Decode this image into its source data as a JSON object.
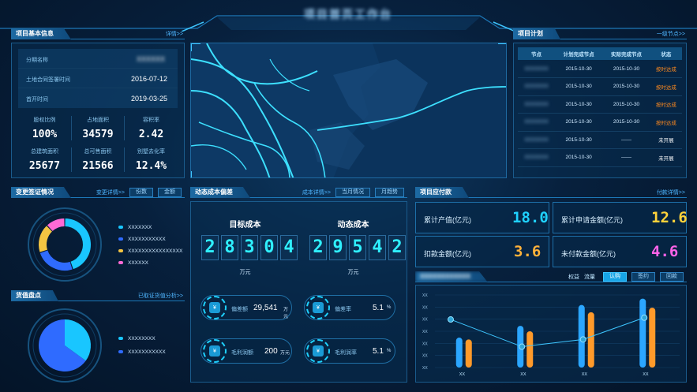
{
  "header": {
    "title": "项目首页工作台"
  },
  "project_info": {
    "title": "项目基本信息",
    "more": "详情>>",
    "rows": [
      {
        "label": "分期名称",
        "value": "XXXXXX"
      },
      {
        "label": "土地合同签署时间",
        "value": "2016-07-12"
      },
      {
        "label": "首开时间",
        "value": "2019-03-25"
      }
    ],
    "stats": [
      {
        "label": "股权比例",
        "value": "100%"
      },
      {
        "label": "占地面积",
        "value": "34579"
      },
      {
        "label": "容积率",
        "value": "2.42"
      },
      {
        "label": "总建筑面积",
        "value": "25677"
      },
      {
        "label": "总可售面积",
        "value": "21566"
      },
      {
        "label": "别墅去化率",
        "value": "12.4%"
      }
    ]
  },
  "change": {
    "title": "变更签证情况",
    "more": "变更详情>>",
    "buttons": [
      "份数",
      "金额"
    ],
    "legend": [
      {
        "label": "XXXXXXX",
        "color": "#19c6ff"
      },
      {
        "label": "XXXXXXXXXXX",
        "color": "#2f6bff"
      },
      {
        "label": "XXXXXXXXXXXXXXXX",
        "color": "#f4c542"
      },
      {
        "label": "XXXXXX",
        "color": "#ff6ad5"
      }
    ],
    "donut": [
      {
        "value": 45,
        "color": "#19c6ff"
      },
      {
        "value": 25,
        "color": "#2f6bff"
      },
      {
        "value": 18,
        "color": "#f4c542"
      },
      {
        "value": 12,
        "color": "#ff6ad5"
      }
    ]
  },
  "goods": {
    "title": "货值盘点",
    "more": "已取证货值分析>>",
    "legend": [
      {
        "label": "XXXXXXXX",
        "color": "#19c6ff"
      },
      {
        "label": "XXXXXXXXXXX",
        "color": "#2f6bff"
      }
    ],
    "pie": [
      {
        "value": 35,
        "color": "#19c6ff"
      },
      {
        "value": 65,
        "color": "#2f6bff"
      }
    ]
  },
  "plan": {
    "title": "项目计划",
    "more": "一级节点>>",
    "columns": [
      "节点",
      "计划完成节点",
      "实际完成节点",
      "状态"
    ],
    "rows": [
      {
        "node": "XXXXXXX",
        "plan": "2015-10-30",
        "actual": "2015-10-30",
        "status": "按时达成",
        "color": "#ff8a1f"
      },
      {
        "node": "XXXXXXX",
        "plan": "2015-10-30",
        "actual": "2015-10-30",
        "status": "按时达成",
        "color": "#ff8a1f"
      },
      {
        "node": "XXXXXXX",
        "plan": "2015-10-30",
        "actual": "2015-10-30",
        "status": "按时达成",
        "color": "#ff8a1f"
      },
      {
        "node": "XXXXXXX",
        "plan": "2015-10-30",
        "actual": "2015-10-30",
        "status": "按时达成",
        "color": "#ff8a1f"
      },
      {
        "node": "XXXXXXX",
        "plan": "2015-10-30",
        "actual": "——",
        "status": "未开展",
        "color": "#ffffff"
      },
      {
        "node": "XXXXXXX",
        "plan": "2015-10-30",
        "actual": "——",
        "status": "未开展",
        "color": "#ffffff"
      }
    ]
  },
  "cost": {
    "title": "动态成本偏差",
    "more": "成本详情>>",
    "buttons": [
      "当月情况",
      "月趋势"
    ],
    "target_label": "目标成本",
    "dynamic_label": "动态成本",
    "target_digits": [
      "2",
      "8",
      "3",
      "0",
      "4"
    ],
    "dynamic_digits": [
      "2",
      "9",
      "5",
      "4",
      "2"
    ],
    "unit": "万元",
    "items": [
      {
        "label": "偏差额",
        "value": "29,541",
        "unit": "万元"
      },
      {
        "label": "偏差率",
        "value": "5.1",
        "unit": "%"
      },
      {
        "label": "毛利润额",
        "value": "200",
        "unit": "万元"
      },
      {
        "label": "毛利润率",
        "value": "5.1",
        "unit": "%"
      }
    ]
  },
  "payable": {
    "title": "项目应付款",
    "more": "付款详情>>",
    "kpis": [
      {
        "label": "累计产值(亿元)",
        "value": "18.0",
        "color": "#1fd1ff"
      },
      {
        "label": "累计申请金额(亿元)",
        "value": "12.6",
        "color": "#ffd23a"
      },
      {
        "label": "扣款金额(亿元)",
        "value": "3.6",
        "color": "#ffb23a"
      },
      {
        "label": "未付款金额(亿元)",
        "value": "4.6",
        "color": "#ff63e8"
      }
    ]
  },
  "sales": {
    "title": "XXXXXXXXXXXX",
    "tabs": [
      "权益",
      "流量"
    ],
    "buttons": [
      "认购",
      "签约",
      "回款"
    ],
    "y_ticks": [
      "XX",
      "XX",
      "XX",
      "XX",
      "XX",
      "XX",
      "XX"
    ],
    "chart_data": {
      "type": "bar",
      "categories": [
        "XX",
        "XX",
        "XX",
        "XX"
      ],
      "series": [
        {
          "values": [
            3.3,
            4.6,
            6.9,
            7.6
          ],
          "color": "#2ba6ff"
        },
        {
          "values": [
            3.1,
            4.0,
            6.1,
            6.6
          ],
          "color": "#ff9a2a"
        }
      ],
      "line": [
        5.3,
        2.3,
        3.1,
        5.5
      ],
      "ylim": [
        0,
        8
      ]
    }
  }
}
